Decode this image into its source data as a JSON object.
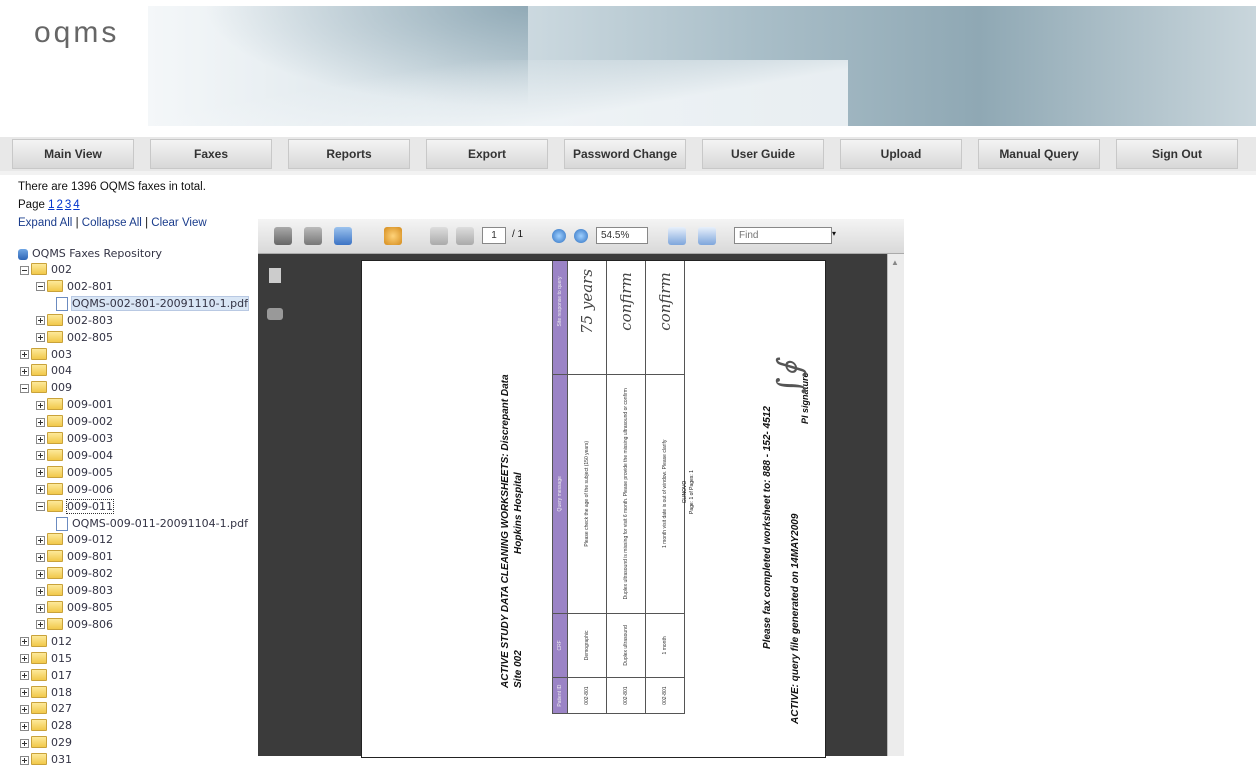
{
  "header": {
    "logo": "oqms"
  },
  "nav": [
    "Main View",
    "Faxes",
    "Reports",
    "Export",
    "Password Change",
    "User Guide",
    "Upload",
    "Manual Query",
    "Sign Out"
  ],
  "info": {
    "total_text": "There are 1396 OQMS faxes in total.",
    "page_label": "Page",
    "pages": [
      "1",
      "2",
      "3",
      "4"
    ]
  },
  "actions": {
    "expand": "Expand All",
    "sep": "|",
    "collapse": "Collapse All",
    "clear": "Clear View"
  },
  "tree": {
    "root": "OQMS Faxes Repository",
    "nodes": [
      {
        "label": "002",
        "depth": 0,
        "type": "folder",
        "expanded": true
      },
      {
        "label": "002-801",
        "depth": 1,
        "type": "folder",
        "expanded": true
      },
      {
        "label": "OQMS-002-801-20091110-1.pdf",
        "depth": 2,
        "type": "file",
        "selected": true
      },
      {
        "label": "002-803",
        "depth": 1,
        "type": "folder"
      },
      {
        "label": "002-805",
        "depth": 1,
        "type": "folder"
      },
      {
        "label": "003",
        "depth": 0,
        "type": "folder"
      },
      {
        "label": "004",
        "depth": 0,
        "type": "folder"
      },
      {
        "label": "009",
        "depth": 0,
        "type": "folder",
        "expanded": true
      },
      {
        "label": "009-001",
        "depth": 1,
        "type": "folder"
      },
      {
        "label": "009-002",
        "depth": 1,
        "type": "folder"
      },
      {
        "label": "009-003",
        "depth": 1,
        "type": "folder"
      },
      {
        "label": "009-004",
        "depth": 1,
        "type": "folder"
      },
      {
        "label": "009-005",
        "depth": 1,
        "type": "folder"
      },
      {
        "label": "009-006",
        "depth": 1,
        "type": "folder"
      },
      {
        "label": "009-011",
        "depth": 1,
        "type": "folder",
        "expanded": true,
        "focused": true
      },
      {
        "label": "OQMS-009-011-20091104-1.pdf",
        "depth": 2,
        "type": "file"
      },
      {
        "label": "009-012",
        "depth": 1,
        "type": "folder"
      },
      {
        "label": "009-801",
        "depth": 1,
        "type": "folder"
      },
      {
        "label": "009-802",
        "depth": 1,
        "type": "folder"
      },
      {
        "label": "009-803",
        "depth": 1,
        "type": "folder"
      },
      {
        "label": "009-805",
        "depth": 1,
        "type": "folder"
      },
      {
        "label": "009-806",
        "depth": 1,
        "type": "folder"
      },
      {
        "label": "012",
        "depth": 0,
        "type": "folder"
      },
      {
        "label": "015",
        "depth": 0,
        "type": "folder"
      },
      {
        "label": "017",
        "depth": 0,
        "type": "folder"
      },
      {
        "label": "018",
        "depth": 0,
        "type": "folder"
      },
      {
        "label": "027",
        "depth": 0,
        "type": "folder"
      },
      {
        "label": "028",
        "depth": 0,
        "type": "folder"
      },
      {
        "label": "029",
        "depth": 0,
        "type": "folder"
      },
      {
        "label": "031",
        "depth": 0,
        "type": "folder"
      }
    ]
  },
  "viewer": {
    "page_current": "1",
    "page_total": "/ 1",
    "zoom": "54.5%",
    "find_placeholder": "Find"
  },
  "document": {
    "title": "ACTIVE STUDY DATA CLEANING WORKSHEETS: Discrepant Data",
    "subtitle1": "Hopkins Hospital",
    "subtitle2": "Site 002",
    "columns": [
      "Patient ID",
      "CRF",
      "Query message",
      "Site response to query"
    ],
    "rows": [
      [
        "002-801",
        "Demographic",
        "Please check the age of the subject (150 years)",
        "75 years"
      ],
      [
        "002-801",
        "Duplex ultrasound",
        "Duplex ultrasound is missing for visit 6 month. Please provide the missing ultrasound or confirm",
        "confirm"
      ],
      [
        "002-801",
        "1 month",
        "1 month visit date is out of window. Please clarify",
        "confirm"
      ]
    ],
    "fax_line": "Please fax completed worksheet to: 888 - 152- 4512",
    "pi_label": "PI signature",
    "generated": "ACTIVE: query file generated on 14MAY2009",
    "footer1": "CLINOVO",
    "footer2": "Page: 1 of Pages: 1"
  }
}
